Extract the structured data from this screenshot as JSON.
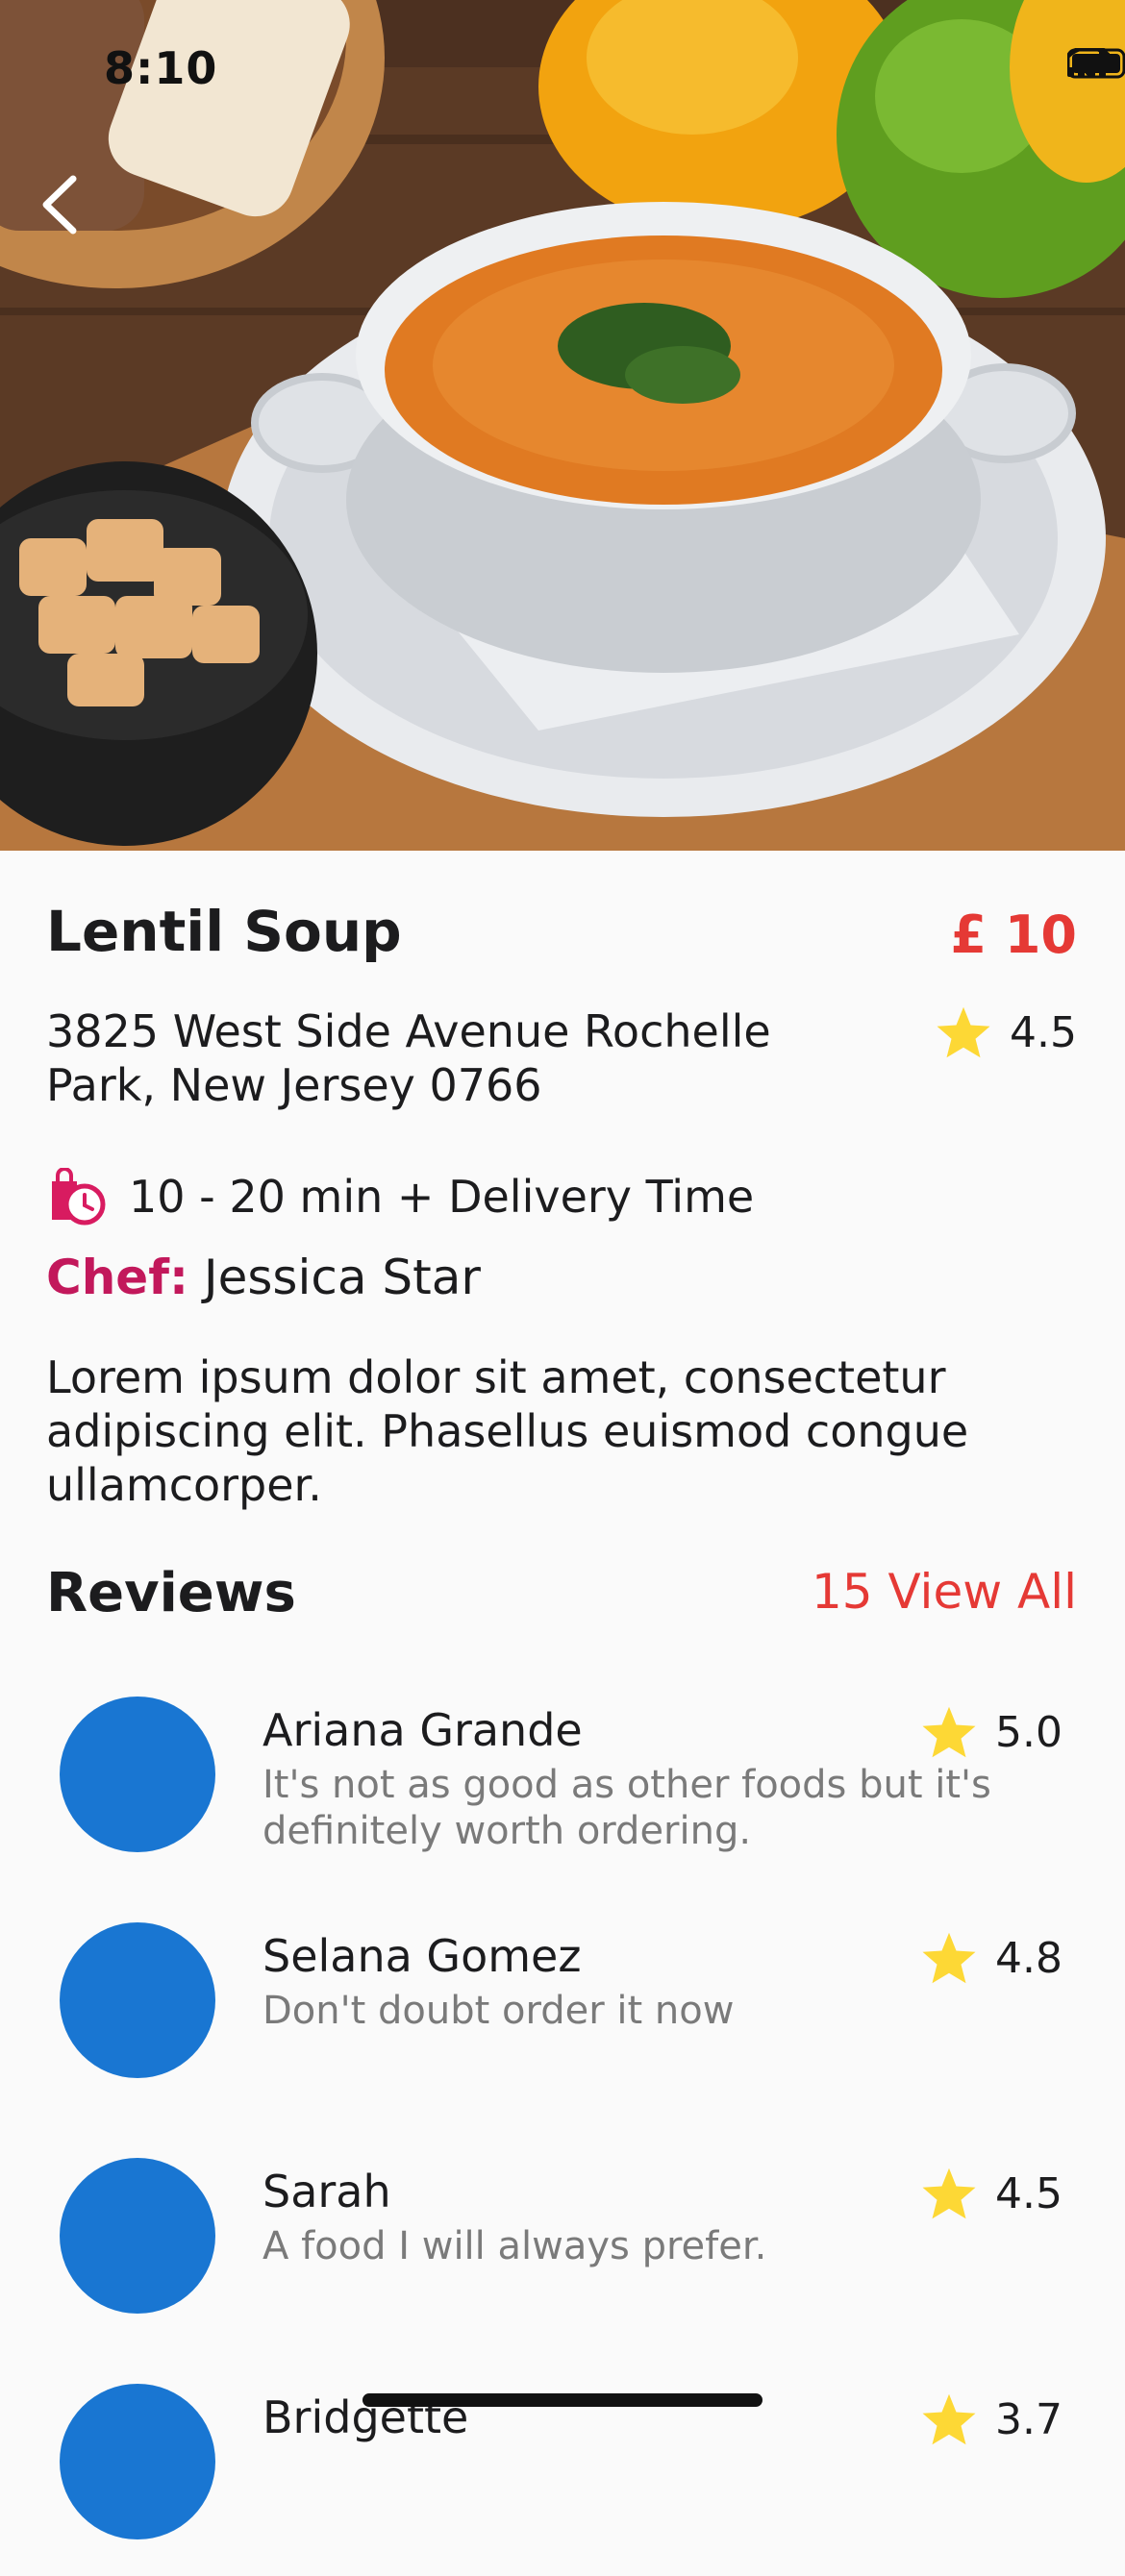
{
  "status_bar": {
    "time": "8:10"
  },
  "dish": {
    "name": "Lentil Soup",
    "price": "£ 10",
    "address": "3825 West Side Avenue Rochelle Park, New Jersey 0766",
    "rating": "4.5",
    "delivery": "10 - 20 min + Delivery Time",
    "chef_label": "Chef:",
    "chef_name": "Jessica Star",
    "description": "Lorem ipsum dolor sit amet, consectetur adipiscing elit. Phasellus euismod congue ullamcorper."
  },
  "reviews": {
    "title": "Reviews",
    "view_all": "15 View All",
    "items": [
      {
        "name": "Ariana Grande",
        "rating": "5.0",
        "text": "It's not as good as other foods but it's definitely worth ordering."
      },
      {
        "name": "Selana Gomez",
        "rating": "4.8",
        "text": "Don't doubt order it now"
      },
      {
        "name": "Sarah",
        "rating": "4.5",
        "text": "A food I will always prefer."
      },
      {
        "name": "Bridgette",
        "rating": "3.7",
        "text": ""
      }
    ]
  },
  "colors": {
    "accent": "#e53935",
    "chef": "#c2185b",
    "star": "#fdd835",
    "avatar": "#1976d2"
  },
  "icons": [
    "back-chevron-icon",
    "star-icon",
    "delivery-timer-icon",
    "wifi-icon",
    "battery-icon",
    "signal-icon"
  ]
}
